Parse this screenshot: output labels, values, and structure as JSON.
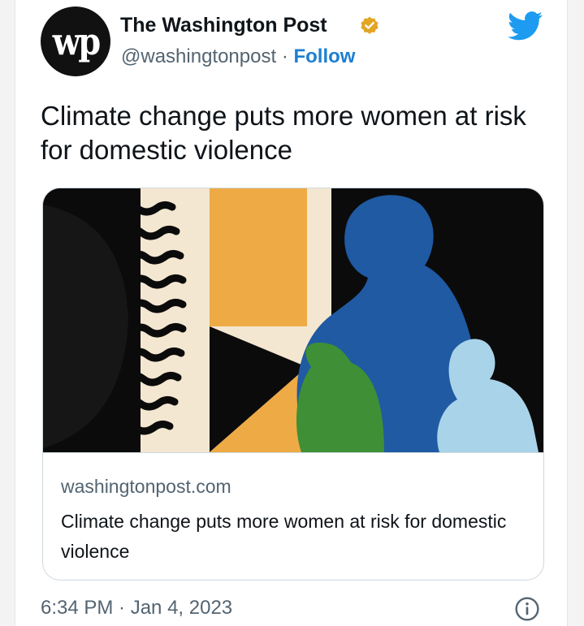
{
  "account": {
    "name": "The Washington Post",
    "handle": "@washingtonpost",
    "separator": " · ",
    "follow_label": "Follow",
    "avatar_monogram": "wp",
    "verified_icon": "verified-badge-gold",
    "brand_icon": "twitter-bird"
  },
  "tweet": {
    "text": "Climate change puts more women at risk for domestic violence",
    "timestamp": "6:34 PM · Jan 4, 2023"
  },
  "card": {
    "domain": "washingtonpost.com",
    "title": "Climate change puts more women at risk for domestic violence",
    "image_icon": "climate-illustration"
  },
  "colors": {
    "link_blue": "#1d7fd1",
    "twitter_blue": "#1d9bf0",
    "verified_gold": "#e2a524",
    "text_primary": "#0f1419",
    "text_secondary": "#536471"
  }
}
